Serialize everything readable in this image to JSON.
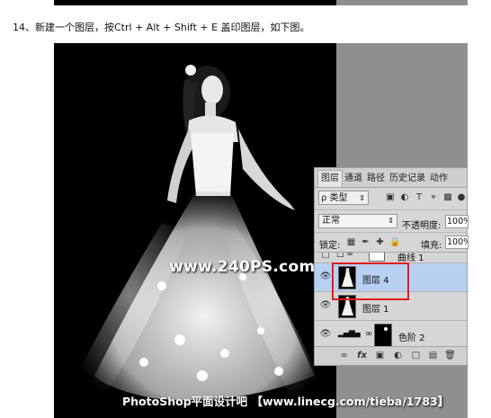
{
  "instruction": "14、新建一个图层，按Ctrl + Alt + Shift + E 盖印图层，如下图。",
  "watermark": "www.240PS.com",
  "credit": "PhotoShop平面设计吧 【www.linecg.com/tieba/1783】",
  "panel": {
    "tabs": [
      "图层",
      "通道",
      "路径",
      "历史记录",
      "动作"
    ],
    "kind_label": "ρ 类型",
    "blend_mode": "正常",
    "opacity_label": "不透明度:",
    "opacity_value": "100%",
    "lock_label": "锁定:",
    "fill_label": "填充:",
    "fill_value": "100%",
    "layers": [
      {
        "name": "曲线 1",
        "selected": false
      },
      {
        "name": "图层 4",
        "selected": true
      },
      {
        "name": "图层 1",
        "selected": false
      },
      {
        "name": "色阶 2",
        "selected": false
      }
    ],
    "bottom_icons": [
      "link-icon",
      "fx-icon",
      "mask-icon",
      "adjustment-icon",
      "group-icon",
      "new-layer-icon",
      "trash-icon"
    ]
  },
  "colors": {
    "selected_layer": "#b8d1f3",
    "highlight_box": "#e21b1b",
    "canvas_background": "#000000",
    "pasteboard": "#8f8f8f"
  }
}
